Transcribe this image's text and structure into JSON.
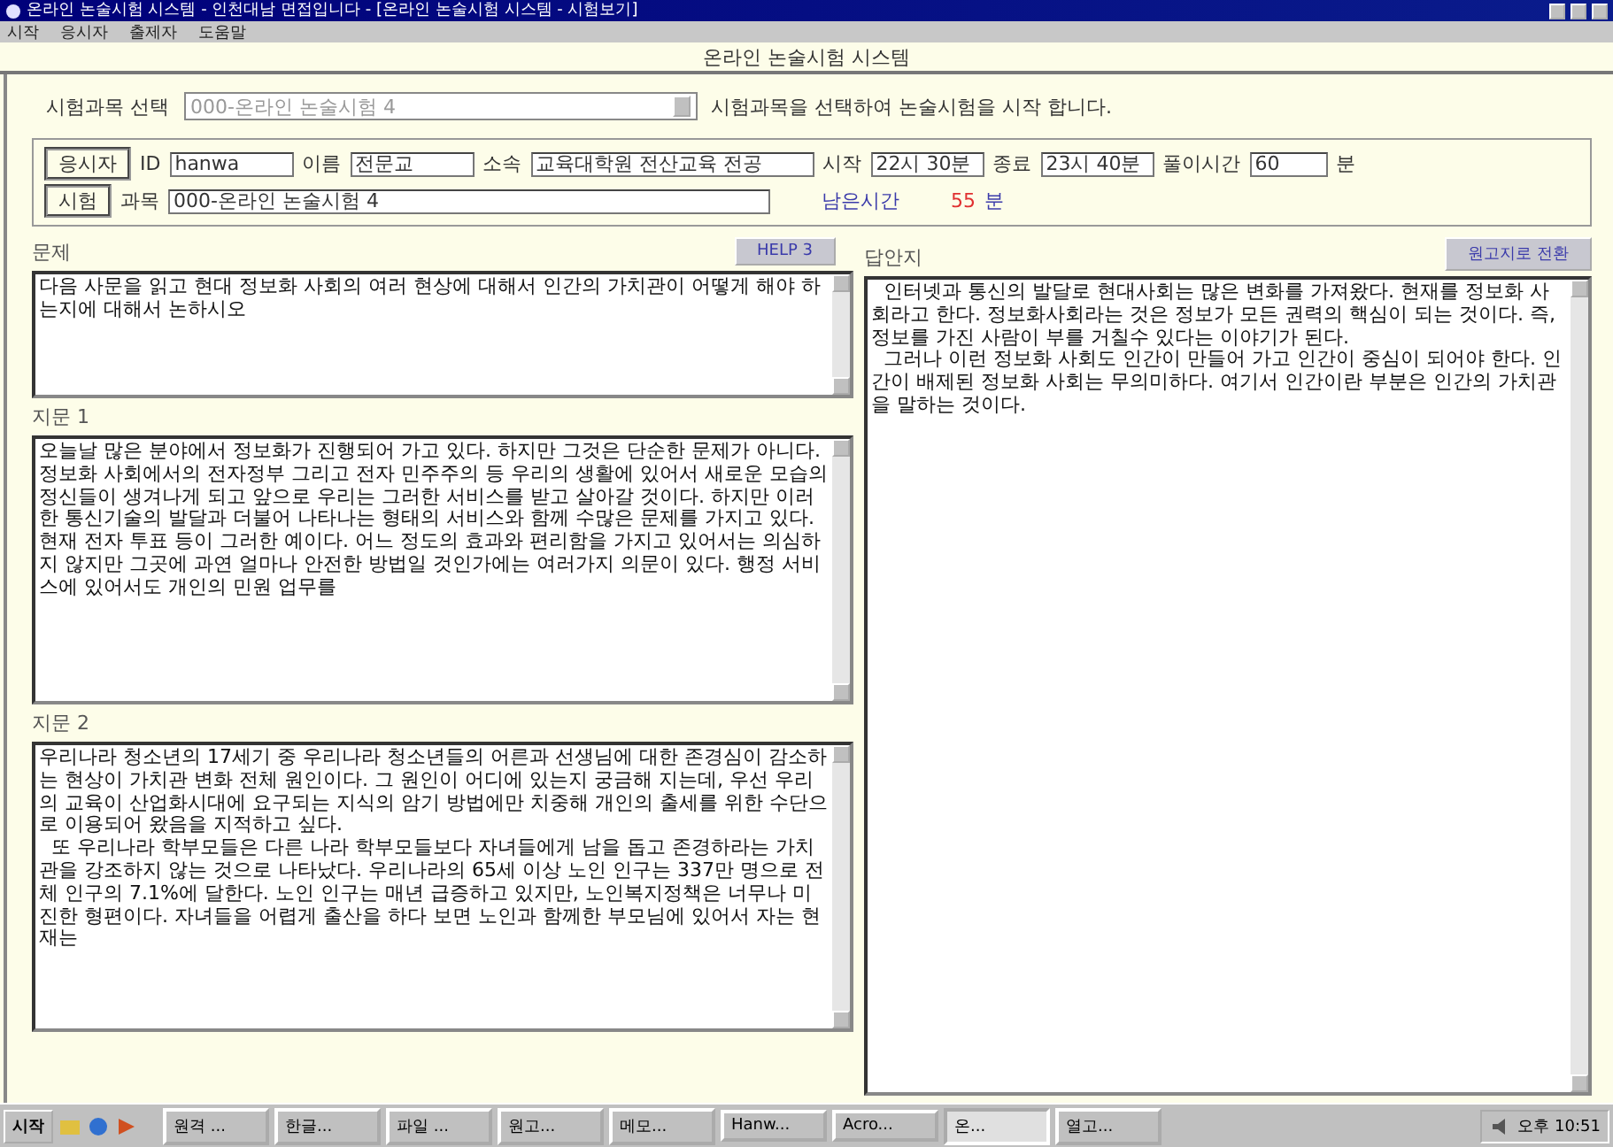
{
  "window": {
    "title": "온라인 논술시험 시스템 - 인천대남 면접입니다 - [온라인 논술시험 시스템 - 시험보기]"
  },
  "menu": [
    "시작",
    "응시자",
    "출제자",
    "도움말"
  ],
  "header_title": "온라인 논술시험 시스템",
  "subject_select": {
    "label": "시험과목 선택",
    "value": "000-온라인 논술시험 4",
    "hint": "시험과목을 선택하여 논술시험을 시작 합니다."
  },
  "examinee": {
    "badge": "응시자",
    "id_label": "ID",
    "id": "hanwa",
    "name_label": "이름",
    "name": "전문교",
    "affiliation_label": "소속",
    "affiliation": "교육대학원 전산교육 전공",
    "start_label": "시작",
    "start": "22시 30분",
    "end_label": "종료",
    "end": "23시 40분",
    "duration_label": "풀이시간",
    "duration": "60",
    "duration_unit": "분"
  },
  "exam": {
    "badge": "시험",
    "subject_label": "과목",
    "subject": "000-온라인 논술시험 4",
    "remaining_label": "남은시간",
    "remaining_value": "55",
    "remaining_unit": "분"
  },
  "question": {
    "label": "문제",
    "button": "HELP 3",
    "text": "다음 사문을 읽고 현대 정보화 사회의 여러 현상에 대해서 인간의 가치관이 어떻게 해야 하는지에 대해서 논하시오"
  },
  "passages": [
    {
      "label": "지문 1",
      "text": "오늘날 많은 분야에서 정보화가 진행되어 가고 있다. 하지만 그것은 단순한 문제가 아니다. 정보화 사회에서의 전자정부 그리고 전자 민주주의 등 우리의 생활에 있어서 새로운 모습의 정신들이 생겨나게 되고 앞으로 우리는 그러한 서비스를 받고 살아갈 것이다. 하지만 이러한 통신기술의 발달과 더불어 나타나는 형태의 서비스와 함께 수많은 문제를 가지고 있다. 현재 전자 투표 등이 그러한 예이다. 어느 정도의 효과와 편리함을 가지고 있어서는 의심하지 않지만 그곳에 과연 얼마나 안전한 방법일 것인가에는 여러가지 의문이 있다. 행정 서비스에 있어서도 개인의 민원 업무를"
    },
    {
      "label": "지문 2",
      "text": "우리나라 청소년의 17세기 중 우리나라 청소년들의 어른과 선생님에 대한 존경심이 감소하는 현상이 가치관 변화 전체 원인이다. 그 원인이 어디에 있는지 궁금해 지는데, 우선 우리의 교육이 산업화시대에 요구되는 지식의 암기 방법에만 치중해 개인의 출세를 위한 수단으로 이용되어 왔음을 지적하고 싶다.\n  또 우리나라 학부모들은 다른 나라 학부모들보다 자녀들에게 남을 돕고 존경하라는 가치관을 강조하지 않는 것으로 나타났다. 우리나라의 65세 이상 노인 인구는 337만 명으로 전체 인구의 7.1%에 달한다. 노인 인구는 매년 급증하고 있지만, 노인복지정책은 너무나 미진한 형편이다. 자녀들을 어렵게 출산을 하다 보면 노인과 함께한 부모님에 있어서 자는 현재는"
    }
  ],
  "answer": {
    "label": "답안지",
    "button": "원고지로 전환",
    "text": "  인터넷과 통신의 발달로 현대사회는 많은 변화를 가져왔다. 현재를 정보화 사회라고 한다. 정보화사회라는 것은 정보가 모든 권력의 핵심이 되는 것이다. 즉, 정보를 가진 사람이 부를 거칠수 있다는 이야기가 된다.\n  그러나 이런 정보화 사회도 인간이 만들어 가고 인간이 중심이 되어야 한다. 인간이 배제된 정보화 사회는 무의미하다. 여기서 인간이란 부분은 인간의 가치관을 말하는 것이다."
  },
  "taskbar": {
    "start": "시작",
    "tasks": [
      {
        "label": "원격 ...",
        "selected": false
      },
      {
        "label": "한글...",
        "selected": false
      },
      {
        "label": "파일 ...",
        "selected": false
      },
      {
        "label": "원고...",
        "selected": false
      },
      {
        "label": "메모...",
        "selected": false
      },
      {
        "label": "Hanw...",
        "selected": false
      },
      {
        "label": "Acro...",
        "selected": false
      },
      {
        "label": "온...",
        "selected": true
      },
      {
        "label": "열고...",
        "selected": false
      }
    ],
    "clock": "오후 10:51"
  }
}
